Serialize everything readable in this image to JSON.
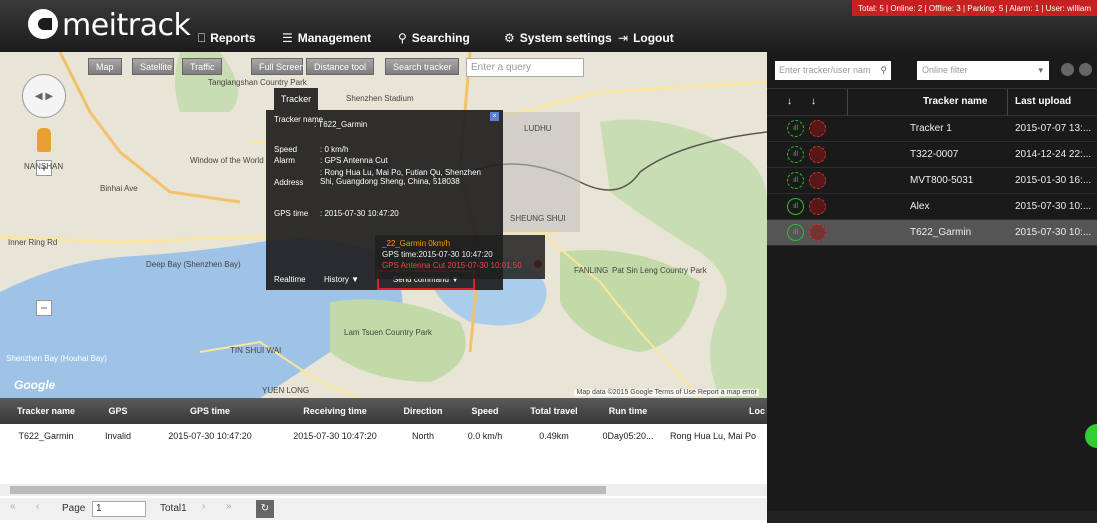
{
  "header": {
    "logo": "meitrack",
    "status": "Total: 5 | Online: 2 | Offline: 3 | Parking: 5 | Alarm: 1 | User: william",
    "nav": [
      {
        "icon": "⎕",
        "label": "Reports"
      },
      {
        "icon": "☰",
        "label": "Management"
      },
      {
        "icon": "⚲",
        "label": "Searching"
      },
      {
        "icon": "⚙",
        "label": "System settings"
      },
      {
        "icon": "⇥",
        "label": "Logout"
      }
    ]
  },
  "map": {
    "tools": [
      "Map",
      "Satellite",
      "Traffic",
      "Full Screen",
      "Distance tool",
      "Search tracker"
    ],
    "query_placeholder": "Enter a query",
    "google": "Google",
    "footer": "Map data ©2015 Google   Terms of Use   Report a map error",
    "labels": [
      "Tanglangshan Country Park",
      "Shenzhen Stadium",
      "LUDHU",
      "Window of the World",
      "NANSHAN",
      "Binhai Ave",
      "Inner Ring Rd",
      "Deep Bay (Shenzhen Bay)",
      "Lam Tsuen Country Park",
      "Pat Sin Leng Country Park",
      "Shenzhen Bay (Houhai Bay)",
      "TIN SHUI WAI",
      "SHEUNG SHUI",
      "FANLING",
      "YUEN LONG"
    ]
  },
  "popup": {
    "tab": "Tracker",
    "rows": [
      {
        "k": "Tracker name",
        "v": ": T622_Garmin"
      },
      {
        "k": "Speed",
        "v": ": 0 km/h"
      },
      {
        "k": "Alarm",
        "v": ": GPS Antenna Cut"
      },
      {
        "k": "Address",
        "v": ": Rong Hua Lu, Mai Po, Futian Qu, Shenzhen Shi, Guangdong Sheng, China, 518038"
      },
      {
        "k": "GPS time",
        "v": ": 2015-07-30 10:47:20"
      }
    ],
    "realtime": "Realtime",
    "history": "History ▼",
    "send": "Send command ▼"
  },
  "info2": {
    "line1": "_22_Garmin 0km/h",
    "line2": "GPS time:2015-07-30 10:47:20",
    "line3": "GPS Antenna Cut 2015-07-30 10:01:50"
  },
  "grid": {
    "headers": [
      "Tracker name",
      "GPS",
      "GPS time",
      "Receiving time",
      "Direction",
      "Speed",
      "Total travel",
      "Run time",
      "Loc"
    ],
    "row": [
      "T622_Garmin",
      "Invalid",
      "2015-07-30 10:47:20",
      "2015-07-30 10:47:20",
      "North",
      "0.0 km/h",
      "0.49km",
      "0Day05:20...",
      "Rong Hua Lu, Mai Po"
    ],
    "page_label": "Page",
    "page": "1",
    "total": "Total1"
  },
  "right": {
    "search_placeholder": "Enter tracker/user nam",
    "filter_placeholder": "Online filter",
    "headers": [
      "Tracker name",
      "Last upload"
    ],
    "rows": [
      {
        "name": "Tracker 1",
        "time": "2015-07-07 13:..."
      },
      {
        "name": "T322-0007",
        "time": "2014-12-24 22:..."
      },
      {
        "name": "MVT800-5031",
        "time": "2015-01-30 16:..."
      },
      {
        "name": "Alex",
        "time": "2015-07-30 10:..."
      },
      {
        "name": "T622_Garmin",
        "time": "2015-07-30 10:..."
      }
    ]
  }
}
